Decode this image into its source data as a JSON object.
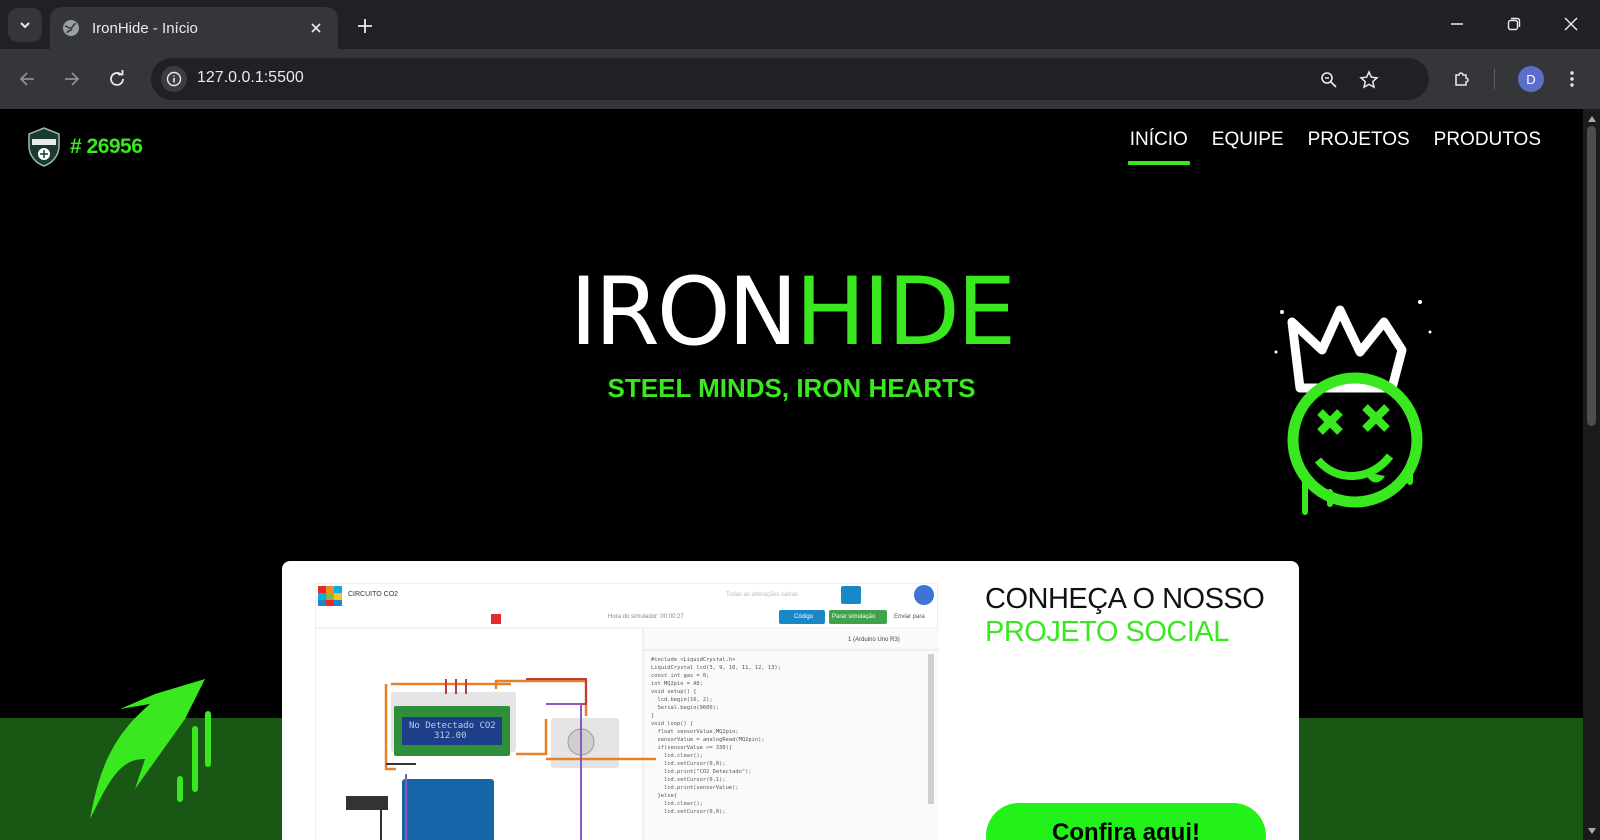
{
  "browser": {
    "tab_title": "IronHide - Início",
    "url": "127.0.0.1:5500",
    "profile_initial": "D"
  },
  "site": {
    "team_number": "# 26956",
    "nav": [
      {
        "label": "INÍCIO",
        "active": true
      },
      {
        "label": "EQUIPE",
        "active": false
      },
      {
        "label": "PROJETOS",
        "active": false
      },
      {
        "label": "PRODUTOS",
        "active": false
      }
    ],
    "hero": {
      "title_white": "IRON",
      "title_green": "HIDE",
      "subtitle": "STEEL MINDS, IRON HEARTS"
    },
    "card": {
      "title_line1": "CONHEÇA O NOSSO",
      "title_line2": "PROJETO SOCIAL",
      "button_label": "Confira aqui!"
    },
    "screenshot": {
      "app_title": "CIRCUITO CO2",
      "saved_text": "Todas as alterações salvas",
      "sim_time": "Hora do simulador: 00:00:27",
      "code_btn": "Código",
      "stop_btn": "Parar simulação",
      "send_btn": "Enviar para",
      "board_select": "1 (Arduino Uno R3)",
      "lcd_line1": "No Detectado CO2",
      "lcd_line2": "312.00",
      "code_lines": [
        "#include <LiquidCrystal.h>",
        "LiquidCrystal lcd(3, 9, 10, 11, 12, 13);",
        "",
        "const int gas = 0;",
        "int MQ2pin = A0;",
        "",
        "void setup() {",
        "  lcd.begin(16, 2);",
        "  Serial.begin(9600);",
        "}",
        "",
        "void loop() {",
        "  float sensorValue,MQ2pin;",
        "  sensorValue = analogRead(MQ2pin);",
        "",
        "  if(sensorValue >= 330){",
        "    lcd.clear();",
        "    lcd.setCursor(0,0);",
        "    lcd.print(\"CO2 Detectado\");",
        "    lcd.setCursor(0,1);",
        "    lcd.print(sensorValue);",
        "  }else{",
        "    lcd.clear();",
        "    lcd.setCursor(0,0);"
      ]
    }
  },
  "colors": {
    "accent": "#39e81f",
    "button": "#22f21a",
    "band": "#195714"
  }
}
